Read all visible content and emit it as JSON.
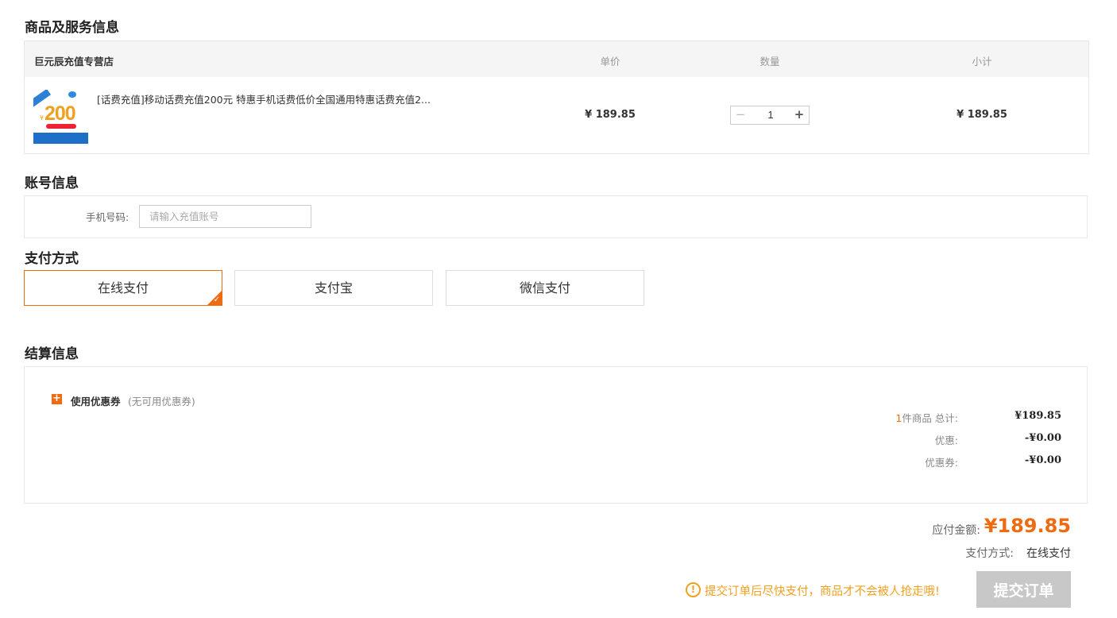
{
  "goods_section": {
    "title": "商品及服务信息",
    "store": "巨元辰充值专营店",
    "columns": {
      "unit_price": "单价",
      "quantity": "数量",
      "subtotal": "小计"
    },
    "item": {
      "thumb_text": "200",
      "thumb_yen": "¥",
      "title": "[话费充值]移动话费充值200元 特惠手机话费低价全国通用特惠话费充值2...",
      "unit_price": "¥ 189.85",
      "quantity": "1",
      "minus": "−",
      "plus": "+",
      "subtotal": "¥ 189.85"
    }
  },
  "account_section": {
    "title": "账号信息",
    "phone_label": "手机号码:",
    "phone_placeholder": "请输入充值账号",
    "phone_value": ""
  },
  "payment_section": {
    "title": "支付方式",
    "options": [
      "在线支付",
      "支付宝",
      "微信支付"
    ],
    "selected": "在线支付",
    "check": "✓"
  },
  "settle_section": {
    "title": "结算信息",
    "coupon_toggle": "+",
    "coupon_label": "使用优惠券",
    "coupon_note": "(无可用优惠券)",
    "rows": {
      "total_count": "1",
      "total_label": "件商品  总计:",
      "total_value": "¥189.85",
      "discount_label": "优惠:",
      "discount_value": "-¥0.00",
      "coupon_label": "优惠券:",
      "coupon_value": "-¥0.00"
    }
  },
  "footer": {
    "due_label": "应付金额:",
    "due_amount": "¥189.85",
    "paymode_label": "支付方式:",
    "paymode_value": "在线支付",
    "warning_icon": "!",
    "warning": "提交订单后尽快支付，商品才不会被人抢走哦!",
    "submit": "提交订单"
  },
  "colors": {
    "accent": "#f06a0f",
    "warning": "#f0a020",
    "submit_disabled": "#c8c8c8"
  }
}
